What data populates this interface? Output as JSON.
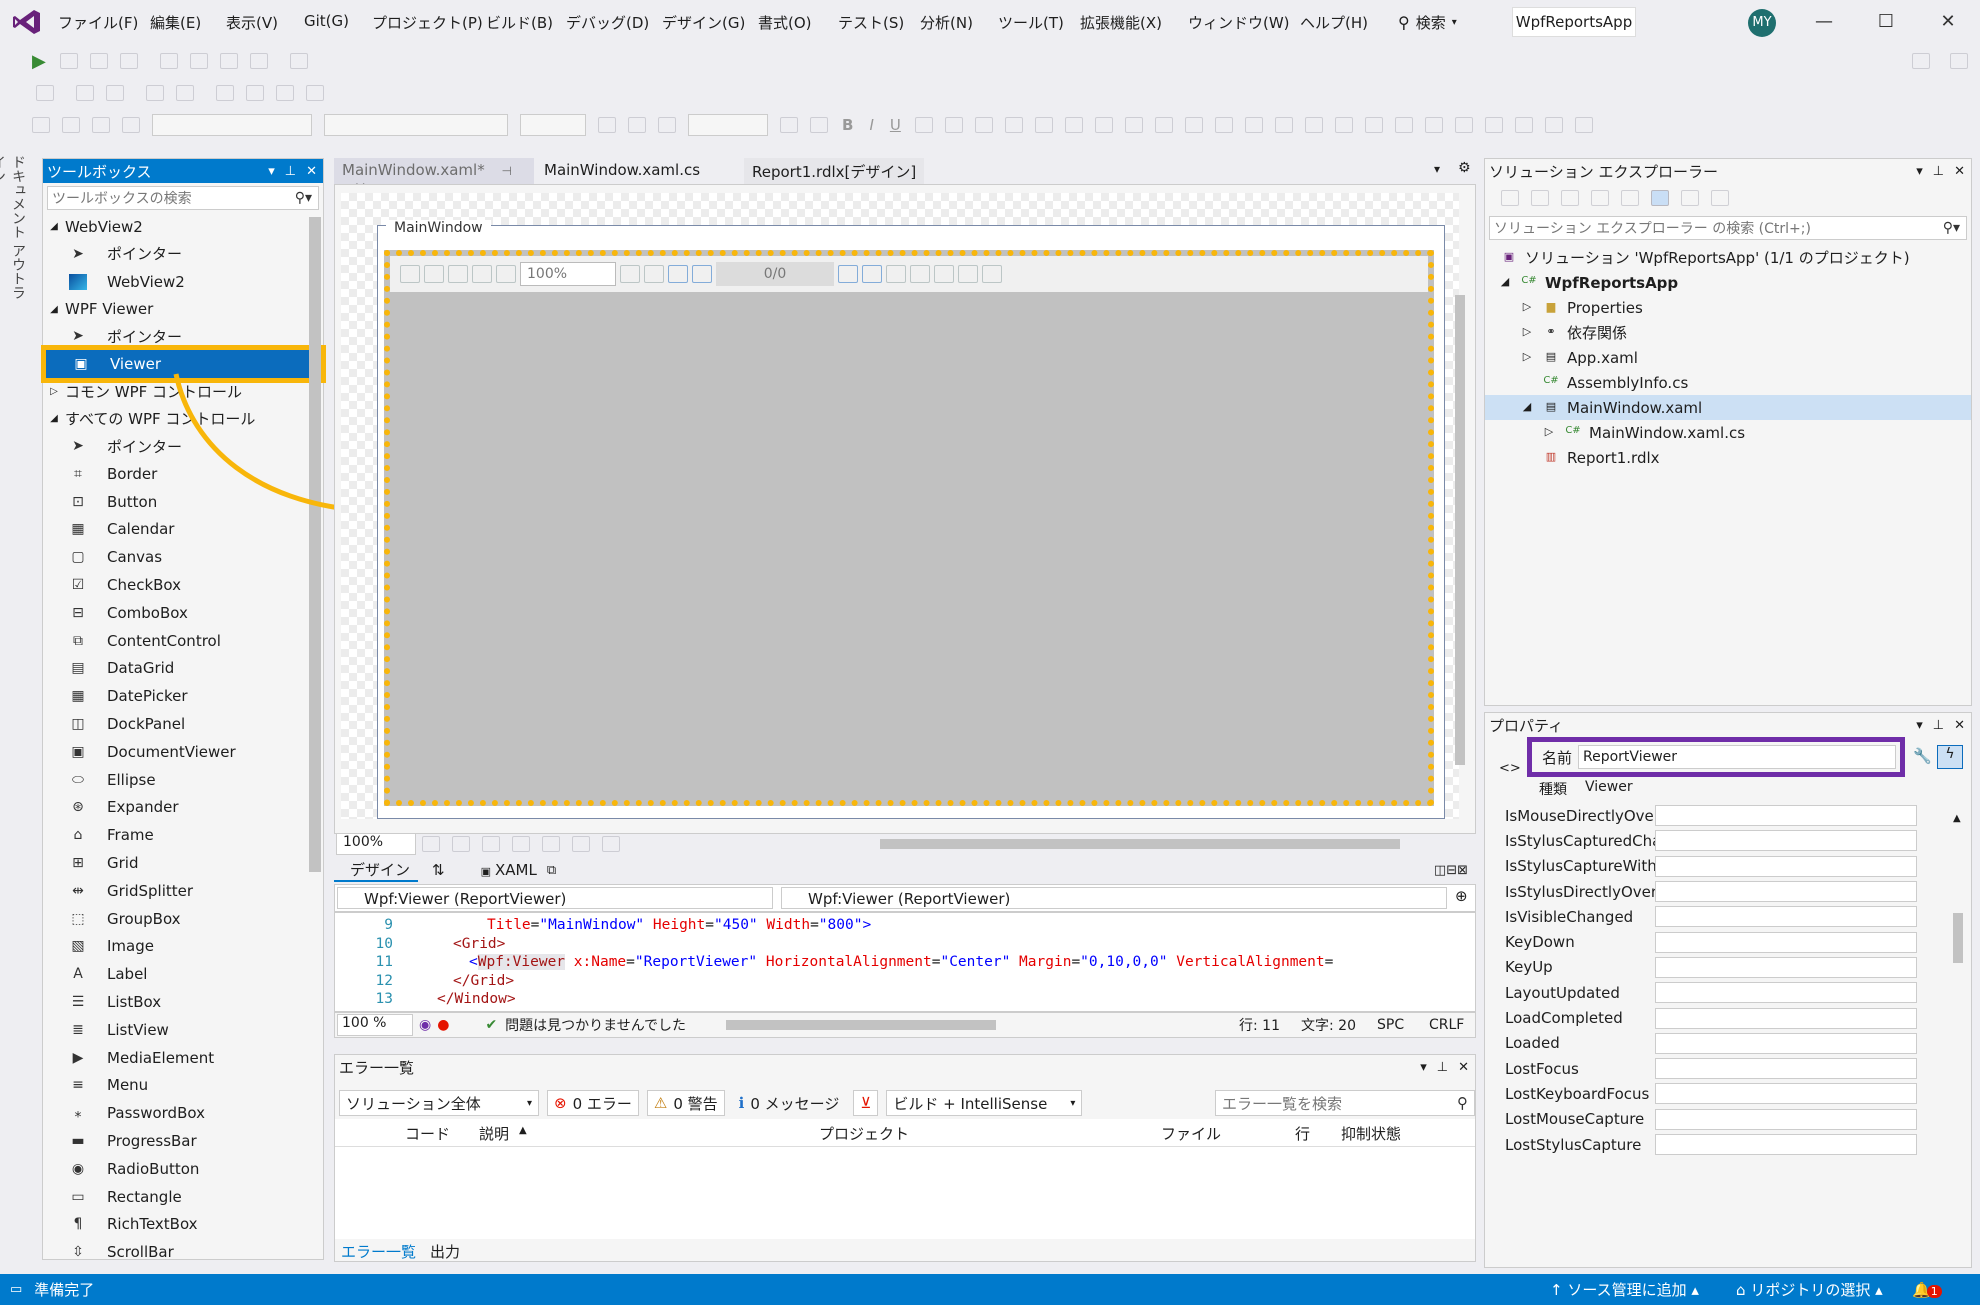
{
  "menubar": {
    "items": [
      "ファイル(F)",
      "編集(E)",
      "表示(V)",
      "Git(G)",
      "プロジェクト(P)",
      "ビルド(B)",
      "デバッグ(D)",
      "デザイン(G)",
      "書式(O)",
      "テスト(S)",
      "分析(N)",
      "ツール(T)",
      "拡張機能(X)",
      "ウィンドウ(W)",
      "ヘルプ(H)"
    ],
    "search_label": "検索",
    "app_name": "WpfReportsApp",
    "user_initials": "MY"
  },
  "side_tab": "ドキュメント アウトライン",
  "toolbox": {
    "title": "ツールボックス",
    "search_placeholder": "ツールボックスの検索",
    "groups": [
      {
        "label": "WebView2",
        "items": [
          "ポインター",
          "WebView2"
        ]
      },
      {
        "label": "WPF Viewer",
        "items": [
          "ポインター",
          "Viewer"
        ]
      },
      {
        "label": "コモン WPF コントロール",
        "items": []
      },
      {
        "label": "すべての WPF コントロール",
        "items": [
          "ポインター",
          "Border",
          "Button",
          "Calendar",
          "Canvas",
          "CheckBox",
          "ComboBox",
          "ContentControl",
          "DataGrid",
          "DatePicker",
          "DockPanel",
          "DocumentViewer",
          "Ellipse",
          "Expander",
          "Frame",
          "Grid",
          "GridSplitter",
          "GroupBox",
          "Image",
          "Label",
          "ListBox",
          "ListView",
          "MediaElement",
          "Menu",
          "PasswordBox",
          "ProgressBar",
          "RadioButton",
          "Rectangle",
          "RichTextBox",
          "ScrollBar"
        ]
      }
    ],
    "selected": "Viewer"
  },
  "editor": {
    "tabs": [
      "MainWindow.xaml*",
      "MainWindow.xaml.cs",
      "Report1.rdlx[デザイン]"
    ],
    "window_title": "MainWindow",
    "viewer_zoom": "100%",
    "viewer_page": "0/0",
    "designer_zoom": "100%",
    "view_tabs": {
      "design": "デザイン",
      "swap": "⇅",
      "xaml": "XAML"
    },
    "selector_left": "Wpf:Viewer (ReportViewer)",
    "selector_right": "Wpf:Viewer (ReportViewer)",
    "code": {
      "line9": {
        "num": "9",
        "attr1": "Title",
        "val1": "\"MainWindow\"",
        "attr2": "Height",
        "val2": "\"450\"",
        "attr3": "Width",
        "val3": "\"800\"",
        "close": ">"
      },
      "line10": {
        "num": "10",
        "tag": "<Grid>"
      },
      "line11": {
        "num": "11",
        "open": "<",
        "tag": "Wpf:Viewer",
        "attr1": "x:Name",
        "val1": "\"ReportViewer\"",
        "attr2": "HorizontalAlignment",
        "val2": "\"Center\"",
        "attr3": "Margin",
        "val3": "\"0,10,0,0\"",
        "attr4": "VerticalAlignment",
        "eq": "="
      },
      "line12": {
        "num": "12",
        "tag": "</Grid>"
      },
      "line13": {
        "num": "13",
        "tag": "</Window>"
      }
    },
    "status": {
      "zoom": "100 %",
      "issues": "問題は見つかりませんでした",
      "line": "行: 11",
      "col": "文字: 20",
      "spc": "SPC",
      "crlf": "CRLF"
    }
  },
  "error_list": {
    "title": "エラー一覧",
    "scope": "ソリューション全体",
    "errors": "0 エラー",
    "warnings": "0 警告",
    "messages": "0 メッセージ",
    "build_filter": "ビルド + IntelliSense",
    "search_placeholder": "エラー一覧を検索",
    "columns": [
      "コード",
      "説明",
      "プロジェクト",
      "ファイル",
      "行",
      "抑制状態"
    ],
    "bottom_tabs": [
      "エラー一覧",
      "出力"
    ]
  },
  "solution_explorer": {
    "title": "ソリューション エクスプローラー",
    "search_placeholder": "ソリューション エクスプローラー の検索 (Ctrl+;)",
    "solution": "ソリューション 'WpfReportsApp' (1/1 のプロジェクト)",
    "project": "WpfReportsApp",
    "items": [
      "Properties",
      "依存関係",
      "App.xaml",
      "AssemblyInfo.cs",
      "MainWindow.xaml",
      "MainWindow.xaml.cs",
      "Report1.rdlx"
    ]
  },
  "properties": {
    "title": "プロパティ",
    "name_label": "名前",
    "name_value": "ReportViewer",
    "type_label": "種類",
    "type_value": "Viewer",
    "events": [
      "IsMouseDirectlyOver...",
      "IsStylusCapturedChan...",
      "IsStylusCaptureWithi...",
      "IsStylusDirectlyOverC...",
      "IsVisibleChanged",
      "KeyDown",
      "KeyUp",
      "LayoutUpdated",
      "LoadCompleted",
      "Loaded",
      "LostFocus",
      "LostKeyboardFocus",
      "LostMouseCapture",
      "LostStylusCapture"
    ]
  },
  "statusbar": {
    "ready": "準備完了",
    "source_control": "ソース管理に追加",
    "repo": "リポジトリの選択",
    "notifications": "1"
  },
  "colors": {
    "accent": "#007acc",
    "highlight": "#f8b60a",
    "name_box": "#6f2da8",
    "selected_item": "#0b6cbd"
  }
}
